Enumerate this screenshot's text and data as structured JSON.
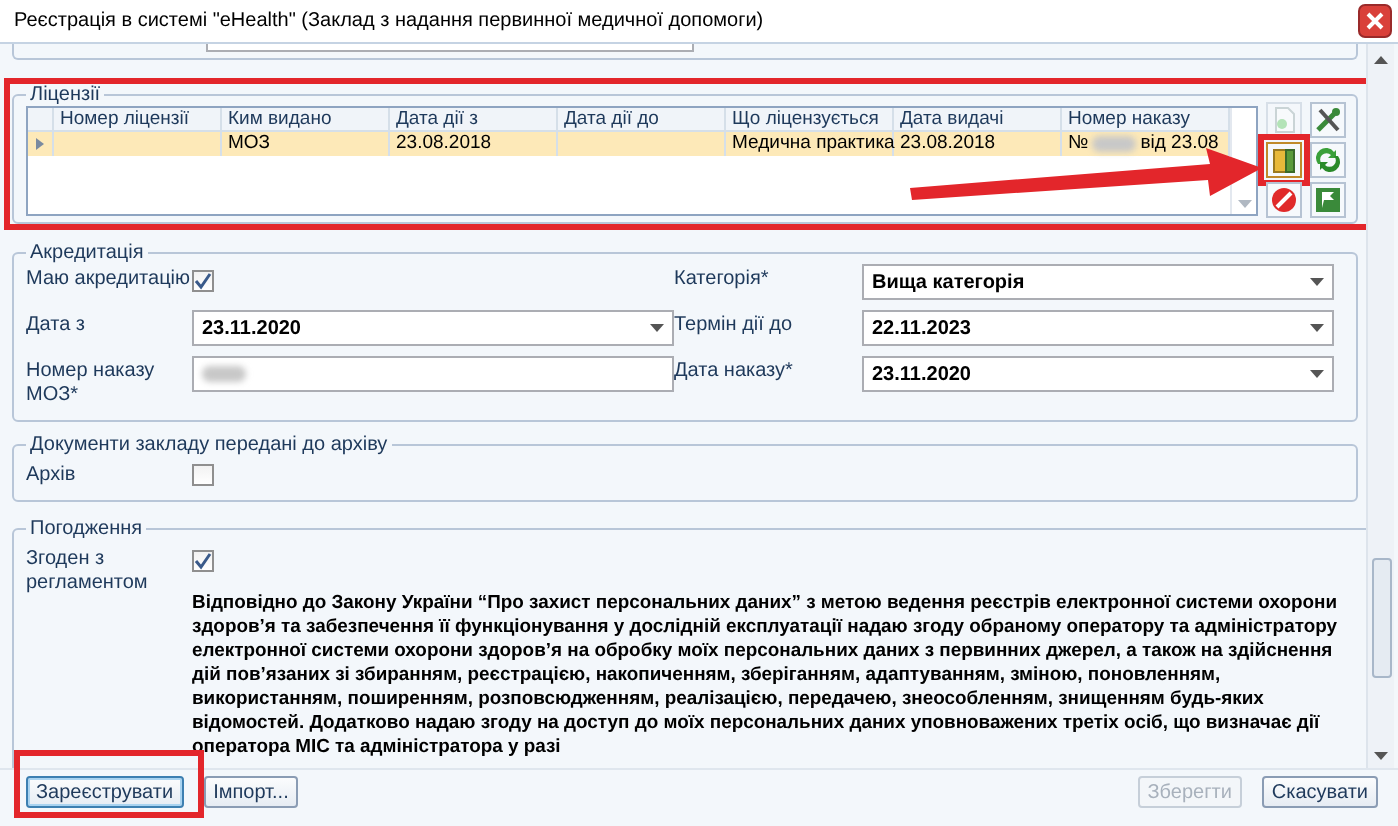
{
  "window": {
    "title": "Реєстрація в системі \"eHealth\" (Заклад з надання первинної медичної допомоги)"
  },
  "licenses": {
    "legend": "Ліцензії",
    "highlighted": true,
    "columns": [
      "Номер ліцензії",
      "Ким видано",
      "Дата дії з",
      "Дата дії до",
      "Що ліцензується",
      "Дата видачі",
      "Номер наказу"
    ],
    "rows": [
      {
        "selected": true,
        "cells": [
          "",
          "МОЗ",
          "23.08.2018",
          "",
          "Медична практика",
          "23.08.2018"
        ],
        "order_number": {
          "prefix": "№",
          "suffix": "від 23.08"
        }
      }
    ],
    "tools": [
      {
        "kind": "new-document",
        "disabled": true,
        "highlighted": false
      },
      {
        "kind": "tools",
        "disabled": false,
        "highlighted": false
      },
      {
        "kind": "book",
        "disabled": false,
        "highlighted": true
      },
      {
        "kind": "refresh",
        "disabled": false,
        "highlighted": false
      },
      {
        "kind": "cancel",
        "disabled": false,
        "highlighted": false
      },
      {
        "kind": "flag",
        "disabled": false,
        "highlighted": false
      }
    ]
  },
  "accreditation": {
    "legend": "Акредитація",
    "has_accreditation": {
      "label": "Маю акредитацію",
      "checked": true
    },
    "date_from": {
      "label": "Дата з",
      "value": "23.11.2020"
    },
    "moz_order": {
      "label": "Номер наказу МОЗ*"
    },
    "category": {
      "label": "Категорія*",
      "value": "Вища категорія"
    },
    "valid_until": {
      "label": "Термін дії до",
      "value": "22.11.2023"
    },
    "order_date": {
      "label": "Дата наказу*",
      "value": "23.11.2020"
    }
  },
  "archive": {
    "legend": "Документи закладу передані до архіву",
    "label": "Архів",
    "checked": false
  },
  "approval": {
    "legend": "Погодження",
    "label": "Згоден з регламентом",
    "checked": true,
    "text": "Відповідно до Закону України “Про захист персональних даних” з метою ведення реєстрів електронної системи охорони здоров’я та забезпечення її функціонування у дослідній експлуатації надаю згоду обраному оператору та адміністратору електронної системи охорони здоров’я на обробку моїх персональних даних з первинних джерел, а також на здійснення дій пов’язаних зі збиранням, реєстрацією, накопиченням, зберіганням, адаптуванням, зміною, поновленням, використанням, поширенням, розповсюдженням, реалізацією, передачею, знеособленням, знищенням будь-яких відомостей. Додатково надаю згоду на доступ до моїх персональних даних уповноважених третіх осіб, що визначає дії оператора МІС та адміністратора у разі"
  },
  "buttons": [
    {
      "label": "Зареєструвати",
      "disabled": false,
      "highlighted": true
    },
    {
      "label": "Імпорт...",
      "disabled": false,
      "highlighted": false
    },
    {
      "label": "Зберегти",
      "disabled": true,
      "highlighted": false
    },
    {
      "label": "Скасувати",
      "disabled": false,
      "highlighted": false
    }
  ]
}
